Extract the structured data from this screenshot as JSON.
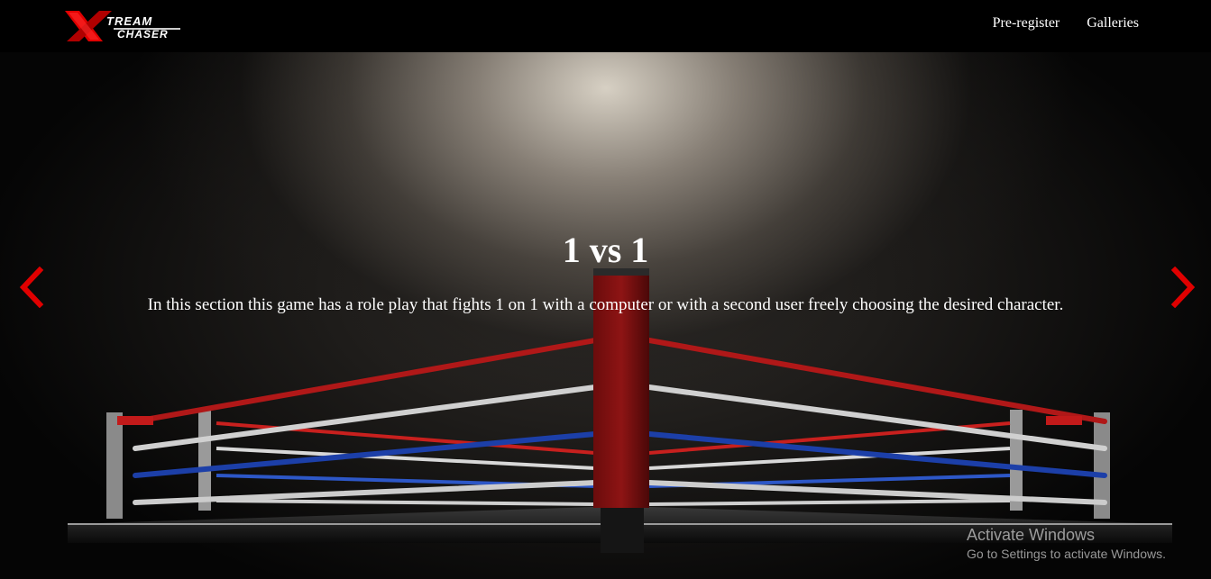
{
  "brand": {
    "logo_top": "TREAM",
    "logo_bottom": "CHASER",
    "logo_letter": "X"
  },
  "nav": {
    "items": [
      {
        "label": "Pre-register"
      },
      {
        "label": "Galleries"
      }
    ]
  },
  "slide": {
    "title": "1 vs 1",
    "text": "In this section this game has a role play that fights 1 on 1 with a computer or with a second user freely choosing the desired character."
  },
  "carousel": {
    "prev_icon": "chevron-left-icon",
    "next_icon": "chevron-right-icon",
    "arrow_color": "#e00000"
  },
  "watermark": {
    "title": "Activate Windows",
    "subtitle": "Go to Settings to activate Windows."
  },
  "colors": {
    "background": "#000000",
    "text": "#ffffff",
    "accent_red": "#e00000",
    "rope_red": "#c8201e",
    "rope_white": "#d8d8d8",
    "rope_blue": "#1c3fa8"
  }
}
